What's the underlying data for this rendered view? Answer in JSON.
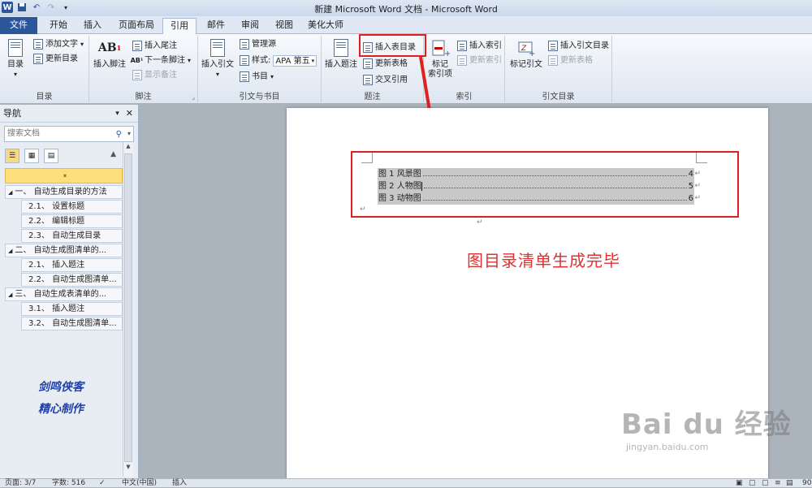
{
  "titlebar": {
    "title": "新建 Microsoft Word 文档 - Microsoft Word",
    "logo": "W"
  },
  "tabs": [
    "文件",
    "开始",
    "插入",
    "页面布局",
    "引用",
    "邮件",
    "审阅",
    "视图",
    "美化大师"
  ],
  "ribbon": {
    "toc_group": {
      "label": "目录",
      "toc_btn": "目录",
      "add_text": "添加文字",
      "update_toc": "更新目录"
    },
    "footnote_group": {
      "label": "脚注",
      "insert_footnote": "插入脚注",
      "insert_endnote": "插入尾注",
      "next_footnote": "下一条脚注",
      "show_notes": "显示备注"
    },
    "citation_group": {
      "label": "引文与书目",
      "insert_citation": "插入引文",
      "manage_sources": "管理源",
      "style_label": "样式:",
      "style_value": "APA 第五",
      "bibliography": "书目"
    },
    "caption_group": {
      "label": "题注",
      "insert_caption": "插入题注",
      "insert_table_of_figures": "插入表目录",
      "update_table": "更新表格",
      "cross_reference": "交叉引用"
    },
    "index_group": {
      "label": "索引",
      "mark_entry": "标记\n索引项",
      "insert_index": "插入索引",
      "update_index": "更新索引"
    },
    "authorities_group": {
      "label": "引文目录",
      "mark_citation": "标记引文",
      "insert_toa": "插入引文目录",
      "update_table": "更新表格"
    }
  },
  "nav": {
    "title": "导航",
    "search_placeholder": "搜索文档",
    "items": [
      {
        "label": "一、 自动生成目录的方法",
        "level": 1
      },
      {
        "label": "2.1、 设置标题",
        "level": 2
      },
      {
        "label": "2.2、 编辑标题",
        "level": 2
      },
      {
        "label": "2.3、 自动生成目录",
        "level": 2
      },
      {
        "label": "二、 自动生成图清单的...",
        "level": 1
      },
      {
        "label": "2.1、 插入题注",
        "level": 2
      },
      {
        "label": "2.2、 自动生成图清单...",
        "level": 2
      },
      {
        "label": "三、 自动生成表清单的...",
        "level": 1
      },
      {
        "label": "3.1、 插入题注",
        "level": 2
      },
      {
        "label": "3.2、 自动生成图清单...",
        "level": 2
      }
    ],
    "signature_line1": "剑鸣侠客",
    "signature_line2": "精心制作"
  },
  "document": {
    "toc_entries": [
      {
        "label": "图 1 风景图",
        "page": "4"
      },
      {
        "label": "图 2 人物图",
        "page": "5"
      },
      {
        "label": "图 3 动物图",
        "page": "6"
      }
    ],
    "caption": "图目录清单生成完毕"
  },
  "statusbar": {
    "page": "页面: 3/7",
    "words": "字数: 516",
    "language": "中文(中国)",
    "mode": "插入",
    "zoom": "90"
  },
  "watermark": {
    "brand": "Bai du 经验",
    "url": "jingyan.baidu.com"
  },
  "colors": {
    "accent": "#2b579a",
    "highlight": "#e02020"
  }
}
